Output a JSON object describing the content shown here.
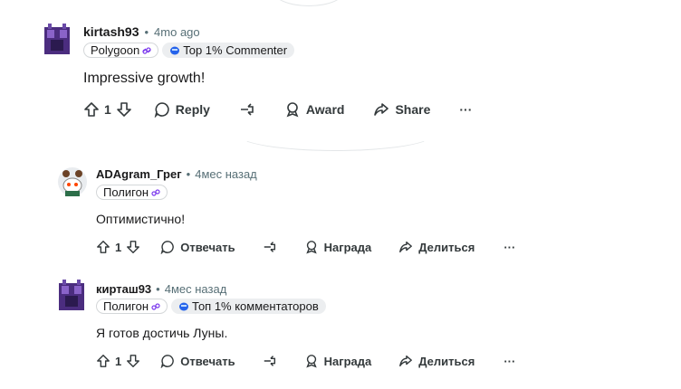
{
  "comments": [
    {
      "username": "kirtash93",
      "sep": "•",
      "time": "4mo ago",
      "flair_user": "Polygoon",
      "flair_badge": "Top 1% Commenter",
      "text": "Impressive growth!",
      "votes": "1",
      "reply": "Reply",
      "award": "Award",
      "share": "Share",
      "more": "···"
    },
    {
      "username": "ADAgram_Грег",
      "sep": "•",
      "time": "4мес назад",
      "flair_user": "Полигон",
      "text": "Оптимистично!",
      "votes": "1",
      "reply": "Отвечать",
      "award": "Награда",
      "share": "Делиться",
      "more": "···"
    },
    {
      "username": "кирташ93",
      "sep": "•",
      "time": "4мес назад",
      "flair_user": "Полигон",
      "flair_badge": "Топ 1% комментаторов",
      "text": "Я готов достичь Луны.",
      "votes": "1",
      "reply": "Отвечать",
      "award": "Награда",
      "share": "Делиться",
      "more": "···"
    }
  ],
  "colors": {
    "username": "#1a1a1b",
    "meta": "#576f76",
    "flair_link": "#7c3aed",
    "badge_icon": "#2563eb"
  }
}
